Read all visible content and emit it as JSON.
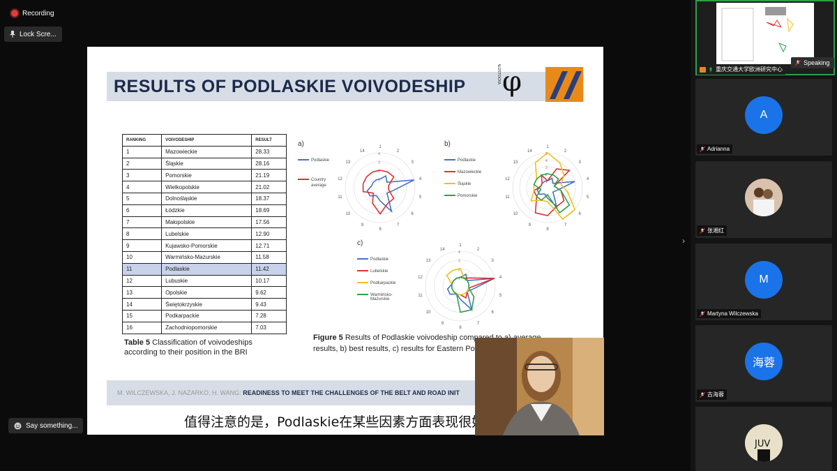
{
  "toolbar": {
    "recording": "Recording",
    "lock_screen": "Lock Scre...",
    "say_something": "Say something..."
  },
  "slide": {
    "title": "RESULTS OF PODLASKIE VOIVODESHIP",
    "logo_text": "POLITECHNIKA BIAŁOSTOCKA",
    "table": {
      "headers": [
        "Ranking",
        "Voivodeship",
        "Result"
      ],
      "rows": [
        [
          "1",
          "Mazowieckie",
          "28.33"
        ],
        [
          "2",
          "Śląskie",
          "28.16"
        ],
        [
          "3",
          "Pomorskie",
          "21.19"
        ],
        [
          "4",
          "Wielkopolskie",
          "21.02"
        ],
        [
          "5",
          "Dolnośląskie",
          "18.37"
        ],
        [
          "6",
          "Łódzkie",
          "18.69"
        ],
        [
          "7",
          "Małopolskie",
          "17.56"
        ],
        [
          "8",
          "Lubelskie",
          "12.90"
        ],
        [
          "9",
          "Kujawsko-Pomorskie",
          "12.71"
        ],
        [
          "10",
          "Warmińsko-Mazurskie",
          "11.58"
        ],
        [
          "11",
          "Podlaskie",
          "11.42"
        ],
        [
          "12",
          "Lubuskie",
          "10.17"
        ],
        [
          "13",
          "Opolskie",
          "9.62"
        ],
        [
          "14",
          "Świętokrzyskie",
          "9.43"
        ],
        [
          "15",
          "Podkarpackie",
          "7.28"
        ],
        [
          "16",
          "Zachodniopomorskie",
          "7.03"
        ]
      ],
      "caption_bold": "Table 5",
      "caption": " Classification of voivodeships according to their position in the BRI"
    },
    "figure_caption_bold": "Figure 5",
    "figure_caption": " Results of Podlaskie voivodeship compared to a) average results, b) best results, c) results for Eastern Po",
    "footer_authors": "M. WILCZEWSKA, J. NAZARKO, H. WANG:",
    "footer_title": "READINESS TO MEET THE CHALLENGES OF THE BELT AND ROAD INIT"
  },
  "chart_data": [
    {
      "type": "radar",
      "panel_label": "a)",
      "axes": [
        "1",
        "2",
        "3",
        "4",
        "5",
        "6",
        "7",
        "8",
        "9",
        "10",
        "11",
        "12",
        "13",
        "14"
      ],
      "rings": [
        "1",
        "2",
        "3",
        "4"
      ],
      "legend_placement": "left",
      "series": [
        {
          "name": "Podlaskie",
          "color": "#4472c4",
          "values": [
            1,
            1.5,
            1,
            4,
            1.5,
            1,
            3,
            1.5,
            1,
            1.5,
            1.5,
            1,
            1,
            1
          ]
        },
        {
          "name": "Country average",
          "color": "#e03030",
          "values": [
            2,
            2,
            2,
            1,
            1,
            2,
            2,
            3,
            2,
            1,
            2,
            2,
            2,
            2
          ]
        }
      ]
    },
    {
      "type": "radar",
      "panel_label": "b)",
      "axes": [
        "1",
        "2",
        "3",
        "4",
        "5",
        "6",
        "7",
        "8",
        "9",
        "10",
        "11",
        "12",
        "13",
        "14"
      ],
      "rings": [
        "1",
        "2",
        "3",
        "4",
        "5"
      ],
      "legend_placement": "left",
      "series": [
        {
          "name": "Podlaskie",
          "color": "#4472c4",
          "values": [
            1,
            1.5,
            1,
            4,
            1.5,
            1,
            3,
            1.5,
            1,
            1.5,
            1.5,
            1,
            1,
            1
          ]
        },
        {
          "name": "Mazowieckie",
          "color": "#e03030",
          "values": [
            1,
            3,
            4,
            1,
            2,
            3,
            3,
            4,
            4,
            2,
            2,
            1,
            1,
            2
          ]
        },
        {
          "name": "Śląskie",
          "color": "#f2c018",
          "values": [
            5,
            4,
            3,
            2,
            3,
            5,
            5,
            2,
            2,
            3,
            2,
            2,
            2,
            4
          ]
        },
        {
          "name": "Pomorskie",
          "color": "#2aa24a",
          "values": [
            2,
            2,
            2,
            1,
            2,
            4,
            4,
            1,
            2,
            2,
            1,
            2,
            2,
            2
          ]
        }
      ]
    },
    {
      "type": "radar",
      "panel_label": "c)",
      "axes": [
        "1",
        "2",
        "3",
        "4",
        "5",
        "6",
        "7",
        "8",
        "9",
        "10",
        "11",
        "12",
        "13",
        "14"
      ],
      "rings": [
        "1",
        "2",
        "3",
        "4"
      ],
      "legend_placement": "left",
      "series": [
        {
          "name": "Podlaskie",
          "color": "#4472c4",
          "values": [
            1,
            1.5,
            1,
            4,
            1.5,
            1,
            3,
            1.5,
            1,
            1.5,
            1.5,
            1,
            1,
            1
          ]
        },
        {
          "name": "Lubelskie",
          "color": "#e03030",
          "values": [
            1,
            1,
            1.5,
            4,
            1,
            1,
            1.5,
            1,
            1,
            1,
            1,
            1,
            1,
            1
          ]
        },
        {
          "name": "Podkarpackie",
          "color": "#f2c018",
          "values": [
            2,
            1,
            1,
            1,
            1,
            1,
            1,
            1,
            1,
            1,
            1,
            1,
            2,
            2
          ]
        },
        {
          "name": "Warmińsko-Mazurskie",
          "color": "#2aa24a",
          "values": [
            1,
            1,
            1,
            1,
            1,
            2,
            3,
            3,
            1,
            1,
            1,
            1,
            1,
            1
          ]
        }
      ]
    }
  ],
  "subtitle": "值得注意的是，Podlaskie在某些因素方面表现很好",
  "sidebar": {
    "share_owner": "重庆交通大学欧洲研究中心",
    "speaking": "Speaking",
    "participants": [
      {
        "initial": "A",
        "name": "Adrianna",
        "avatar": "letter"
      },
      {
        "initial": "",
        "name": "张湘红",
        "avatar": "photo"
      },
      {
        "initial": "M",
        "name": "Martyna Wilczewska",
        "avatar": "letter"
      },
      {
        "initial": "海蓉",
        "name": "古海蓉",
        "avatar": "letter"
      },
      {
        "initial": "",
        "name": "",
        "avatar": "photo"
      }
    ]
  },
  "colors": {
    "accent_blue": "#1a73e8",
    "slide_band": "#d7dde6",
    "title_text": "#1c2a4a",
    "highlight_row": "#c8d2ea",
    "active_green": "#2aa24a"
  }
}
